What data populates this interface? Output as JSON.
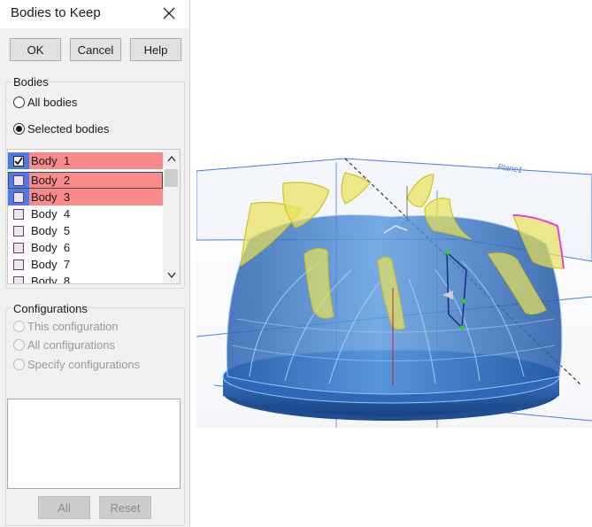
{
  "dialog": {
    "title": "Bodies to Keep",
    "buttons": {
      "ok": "OK",
      "cancel": "Cancel",
      "help": "Help"
    },
    "bodies_group": {
      "label": "Bodies",
      "radio_all": "All bodies",
      "radio_selected": "Selected bodies",
      "selected_option": "Selected bodies",
      "items": [
        {
          "label": "Body  1",
          "checked": true,
          "highlighted": true
        },
        {
          "label": "Body  2",
          "checked": false,
          "highlighted": true
        },
        {
          "label": "Body  3",
          "checked": false,
          "highlighted": true
        },
        {
          "label": "Body  4",
          "checked": false,
          "highlighted": false
        },
        {
          "label": "Body  5",
          "checked": false,
          "highlighted": false
        },
        {
          "label": "Body  6",
          "checked": false,
          "highlighted": false
        },
        {
          "label": "Body  7",
          "checked": false,
          "highlighted": false
        },
        {
          "label": "Body  8",
          "checked": false,
          "highlighted": false
        }
      ]
    },
    "configurations_group": {
      "label": "Configurations",
      "radio_this": "This configuration",
      "radio_all": "All configurations",
      "radio_specify": "Specify configurations",
      "btn_all": "All",
      "btn_reset": "Reset"
    }
  },
  "viewport": {
    "plane_label": "Plane1",
    "colors": {
      "body_fill": "#3a78c9",
      "blade_highlight": "#e8e35a",
      "selected_edge": "#e040e0",
      "plane_line": "#4a7bd8",
      "background": "#ffffff"
    }
  }
}
